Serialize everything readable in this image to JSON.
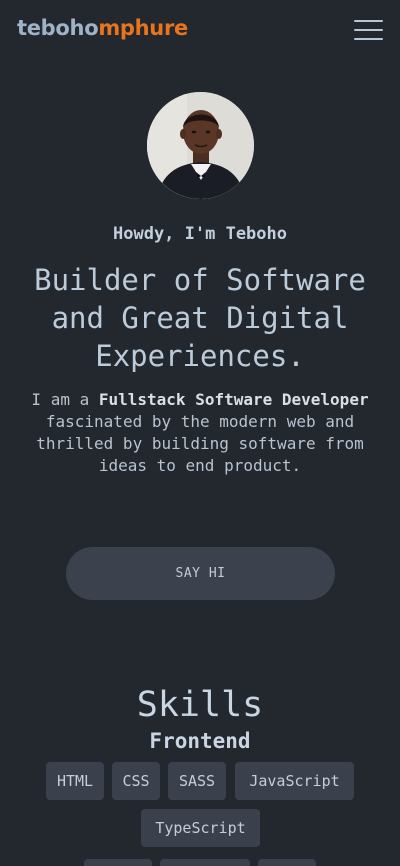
{
  "header": {
    "logo_first": "teboho",
    "logo_last": "mphure",
    "menu_icon": "hamburger-menu-icon"
  },
  "hero": {
    "avatar_icon": "profile-photo",
    "greeting": "Howdy, I'm Teboho",
    "headline": "Builder of Software and Great Digital Experiences.",
    "intro_prefix": "I am a ",
    "intro_bold": "Fullstack Software Developer",
    "intro_suffix": " fascinated by the modern web and thrilled by building software from ideas to end product.",
    "cta_label": "SAY HI"
  },
  "skills": {
    "title": "Skills",
    "frontend_title": "Frontend",
    "frontend_tags": [
      "HTML",
      "CSS",
      "SASS",
      "JavaScript",
      "TypeScript"
    ]
  },
  "colors": {
    "background": "#23272e",
    "accent": "#e8741d",
    "logo_first": "#9fb3c8",
    "button": "#3b424d"
  }
}
